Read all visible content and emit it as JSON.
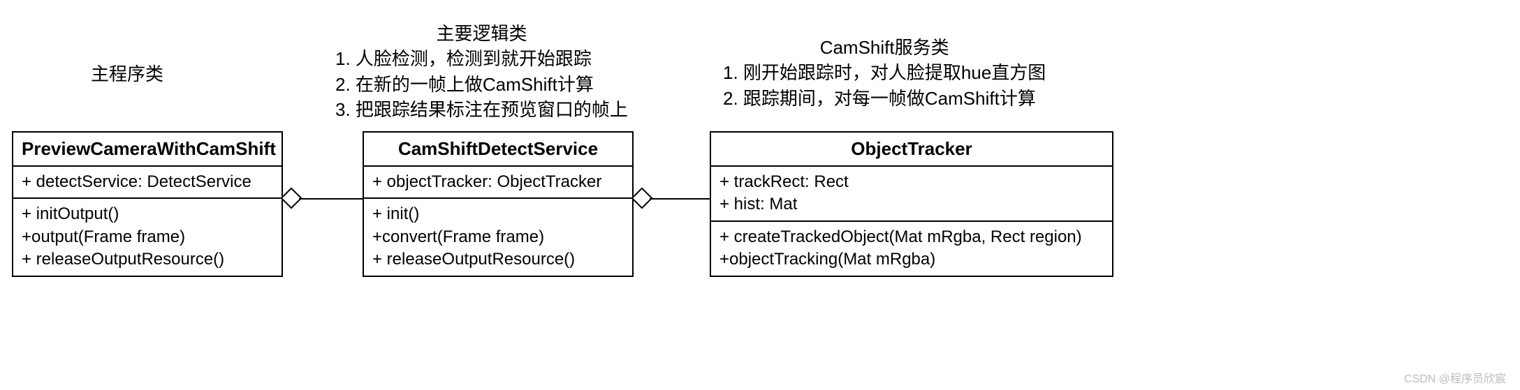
{
  "descriptions": {
    "left": "主程序类",
    "mid_title": "主要逻辑类",
    "mid_1": "1. 人脸检测，检测到就开始跟踪",
    "mid_2": "2. 在新的一帧上做CamShift计算",
    "mid_3": "3. 把跟踪结果标注在预览窗口的帧上",
    "right_title": "CamShift服务类",
    "right_1": "1. 刚开始跟踪时，对人脸提取hue直方图",
    "right_2": "2. 跟踪期间，对每一帧做CamShift计算"
  },
  "classes": {
    "preview": {
      "name": "PreviewCameraWithCamShift",
      "attrs": [
        "+ detectService: DetectService"
      ],
      "methods": [
        "+ initOutput()",
        "+output(Frame frame)",
        "+ releaseOutputResource()"
      ]
    },
    "detect": {
      "name": "CamShiftDetectService",
      "attrs": [
        "+ objectTracker: ObjectTracker"
      ],
      "methods": [
        "+ init()",
        "+convert(Frame frame)",
        "+ releaseOutputResource()"
      ]
    },
    "tracker": {
      "name": "ObjectTracker",
      "attrs": [
        "+ trackRect: Rect",
        "+ hist: Mat"
      ],
      "methods": [
        "+ createTrackedObject(Mat mRgba, Rect region)",
        "+objectTracking(Mat mRgba)"
      ]
    }
  },
  "watermark": "CSDN @程序员欣宸"
}
